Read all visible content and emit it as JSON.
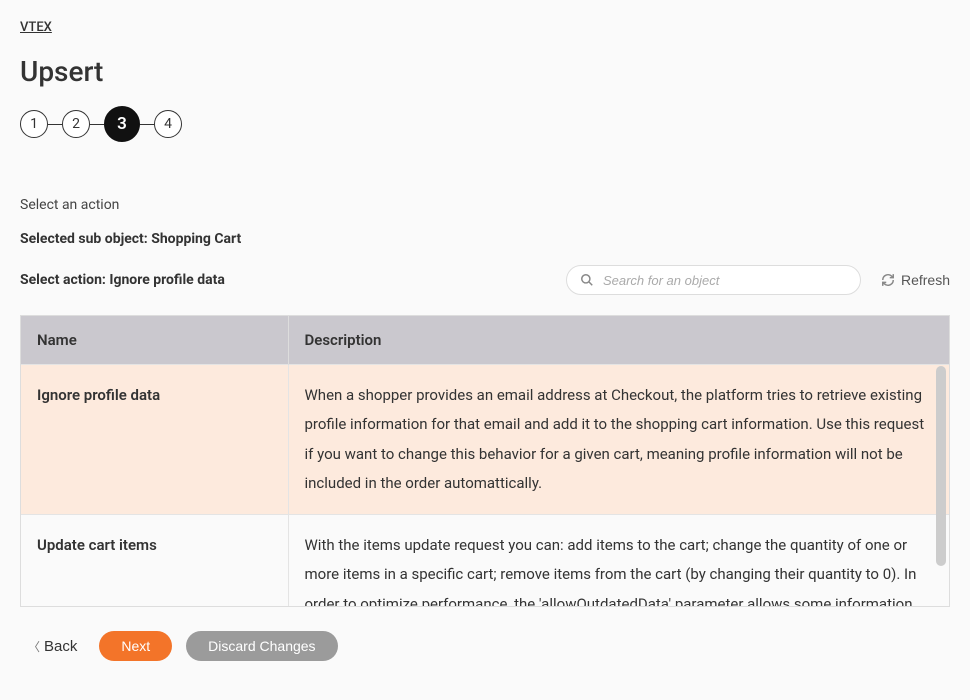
{
  "breadcrumb": "VTEX",
  "title": "Upsert",
  "stepper": {
    "steps": [
      "1",
      "2",
      "3",
      "4"
    ],
    "active_index": 2
  },
  "section_label": "Select an action",
  "sub_object_line": "Selected sub object: Shopping Cart",
  "action_line": "Select action: Ignore profile data",
  "search": {
    "placeholder": "Search for an object"
  },
  "refresh_label": "Refresh",
  "table": {
    "columns": {
      "name": "Name",
      "description": "Description"
    },
    "rows": [
      {
        "name": "Ignore profile data",
        "description": "When a shopper provides an email address at Checkout, the platform tries to retrieve existing profile information for that email and add it to the shopping cart information. Use this request if you want to change this behavior for a given cart, meaning profile information will not be included in the order automattically.",
        "selected": true
      },
      {
        "name": "Update cart items",
        "description": "With the items update request you can: add items to the cart; change the quantity of one or more items in a specific cart; remove items from the cart (by changing their quantity to 0). In order to optimize performance, the 'allowOutdatedData' parameter allows some information to",
        "selected": false
      }
    ]
  },
  "footer": {
    "back": "Back",
    "next": "Next",
    "discard": "Discard Changes"
  }
}
